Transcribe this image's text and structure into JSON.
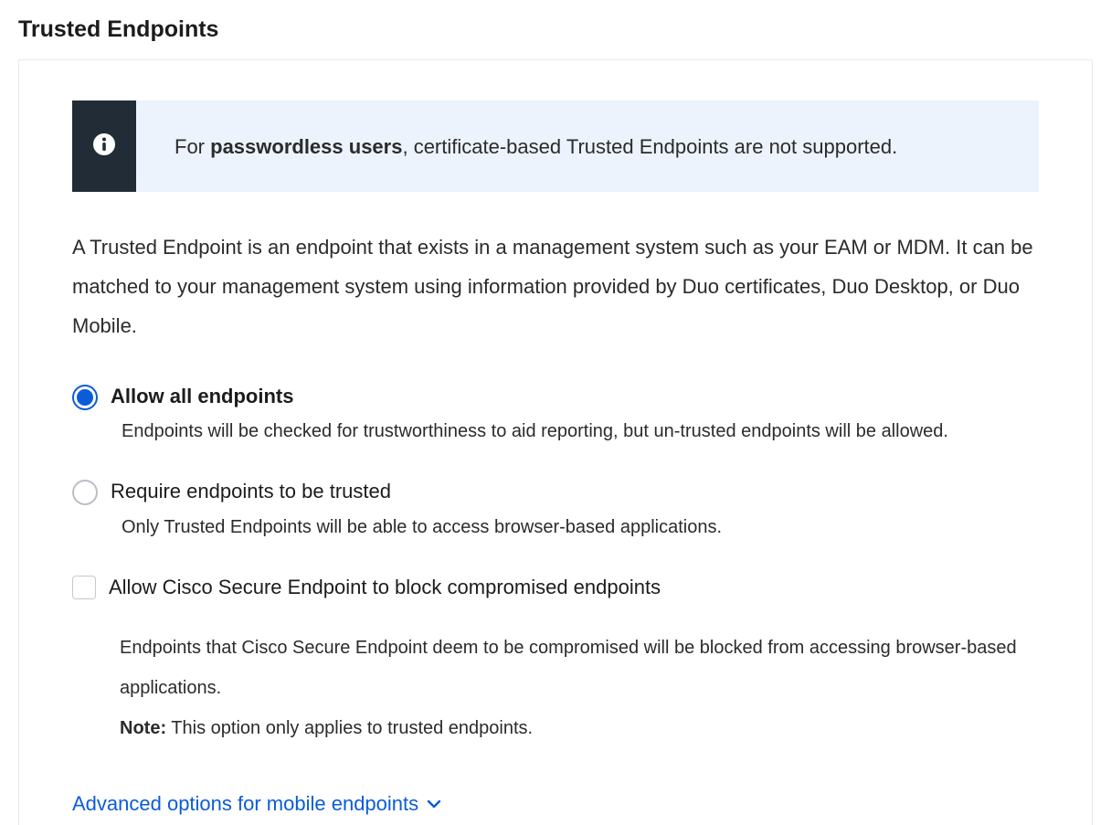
{
  "title": "Trusted Endpoints",
  "info": {
    "prefix": "For ",
    "bold": "passwordless users",
    "suffix": ", certificate-based Trusted Endpoints are not supported."
  },
  "description": "A Trusted Endpoint is an endpoint that exists in a management system such as your EAM or MDM. It can be matched to your management system using information provided by Duo certificates, Duo Desktop, or Duo Mobile.",
  "options": {
    "allow_all": {
      "label": "Allow all endpoints",
      "subtext": "Endpoints will be checked for trustworthiness to aid reporting, but un-trusted endpoints will be allowed.",
      "selected": true
    },
    "require_trusted": {
      "label": "Require endpoints to be trusted",
      "subtext": "Only Trusted Endpoints will be able to access browser-based applications.",
      "selected": false
    }
  },
  "secure_endpoint": {
    "label": "Allow Cisco Secure Endpoint to block compromised endpoints",
    "checked": false,
    "description": "Endpoints that Cisco Secure Endpoint deem to be compromised will be blocked from accessing browser-based applications.",
    "note_label": "Note:",
    "note_text": " This option only applies to trusted endpoints."
  },
  "advanced_link": "Advanced options for mobile endpoints"
}
